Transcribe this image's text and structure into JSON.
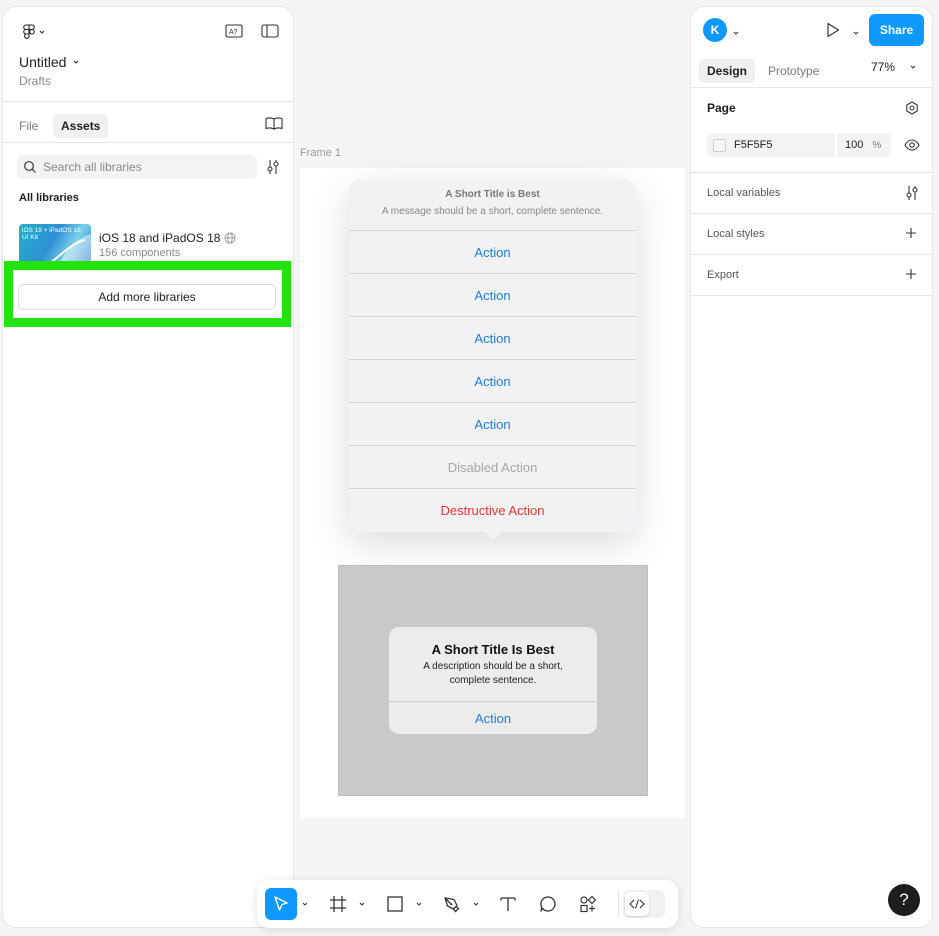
{
  "left_panel": {
    "file_name": "Untitled",
    "location": "Drafts",
    "tabs": [
      "File",
      "Assets"
    ],
    "search_placeholder": "Search all libraries",
    "section_title": "All libraries",
    "library": {
      "name": "iOS 18 and iPadOS 18",
      "count": "156 components",
      "thumb_text": "iOS 18 + iPadOS 18 UI Kit"
    },
    "add_libraries": "Add more libraries"
  },
  "canvas": {
    "frame_label": "Frame 1",
    "action_sheet": {
      "title": "A Short Title is Best",
      "message": "A message should be a short, complete sentence.",
      "actions": [
        "Action",
        "Action",
        "Action",
        "Action",
        "Action"
      ],
      "disabled": "Disabled Action",
      "destructive": "Destructive Action"
    },
    "alert": {
      "title": "A Short Title Is Best",
      "description_line1": "A description should be a short,",
      "description_line2": "complete sentence.",
      "action": "Action"
    }
  },
  "right_panel": {
    "avatar_initial": "K",
    "share_label": "Share",
    "tabs": [
      "Design",
      "Prototype"
    ],
    "zoom": "77%",
    "page_label": "Page",
    "page_color": "F5F5F5",
    "page_opacity": "100",
    "percent_sign": "%",
    "sections": [
      "Local variables",
      "Local styles",
      "Export"
    ]
  },
  "help_label": "?",
  "colors": {
    "accent": "#0d99ff",
    "ios_blue": "#1a7de1",
    "destructive": "#e5382e",
    "highlight": "#22e30c"
  }
}
